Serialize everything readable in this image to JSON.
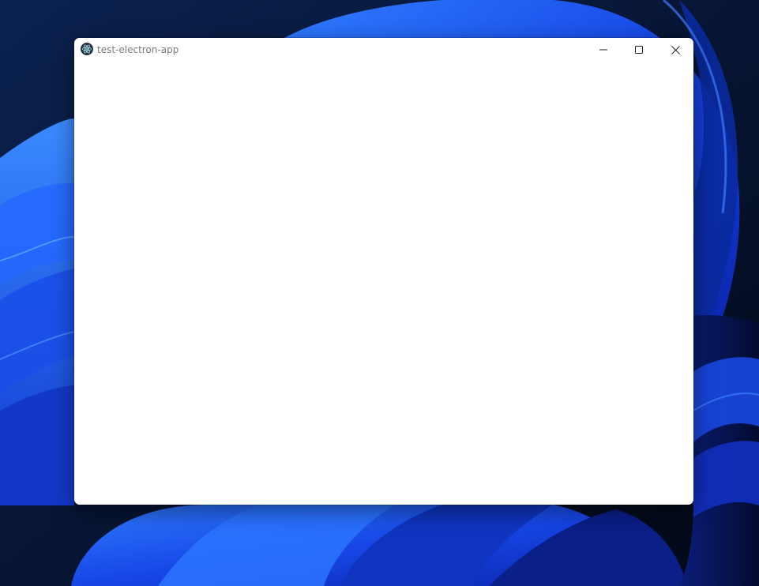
{
  "window": {
    "title": "test-electron-app",
    "app_icon": "electron-icon",
    "controls": {
      "minimize_icon": "minimize-icon",
      "maximize_icon": "maximize-icon",
      "close_icon": "close-icon"
    }
  },
  "colors": {
    "desktop_dark": "#081a3e",
    "wallpaper_blue": "#1a4fe0",
    "window_background": "#ffffff",
    "title_text": "#7a7a7a"
  }
}
